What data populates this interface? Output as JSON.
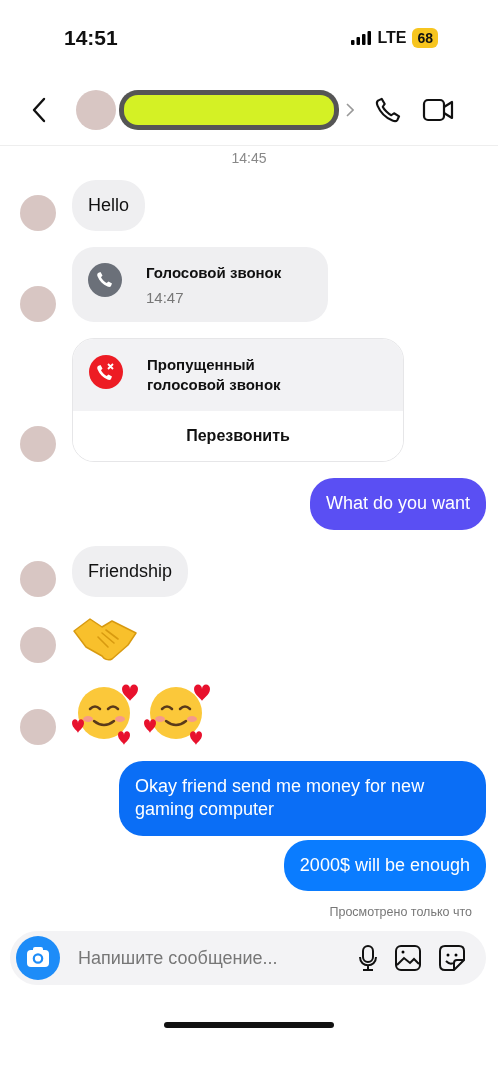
{
  "status_bar": {
    "time": "14:51",
    "network": "LTE",
    "battery": "68"
  },
  "timestamp": "14:45",
  "messages": [
    {
      "kind": "text",
      "outgoing": false,
      "text": "Hello"
    },
    {
      "kind": "call",
      "outgoing": false,
      "title": "Голосовой звонок",
      "time": "14:47"
    },
    {
      "kind": "missed_call",
      "outgoing": false,
      "title": "Пропущенный голосовой звонок",
      "action": "Перезвонить"
    },
    {
      "kind": "text",
      "outgoing": true,
      "text": "What do you want",
      "color": "#5a4ff3"
    },
    {
      "kind": "text",
      "outgoing": false,
      "text": "Friendship"
    },
    {
      "kind": "handshake",
      "outgoing": false
    },
    {
      "kind": "hearts_faces",
      "outgoing": false
    },
    {
      "kind": "text",
      "outgoing": true,
      "text": "Okay friend send me money for new gaming computer",
      "color": "#0a6ef6"
    },
    {
      "kind": "text",
      "outgoing": true,
      "text": "2000$ will be enough",
      "color": "#0a7cff"
    }
  ],
  "seen": "Просмотрено только что",
  "composer": {
    "placeholder": "Напишите сообщение..."
  }
}
